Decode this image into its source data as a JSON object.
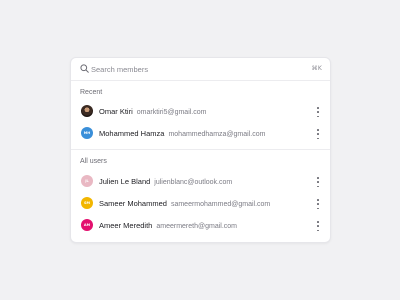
{
  "search": {
    "placeholder": "Search members",
    "shortcut": "⌘K"
  },
  "sections": {
    "recent_title": "Recent",
    "all_title": "All users"
  },
  "recent": [
    {
      "name": "Omar Ktiri",
      "email": "omarktiri5@gmail.com",
      "avatar_initials": "",
      "avatar_color": "#2a1d17"
    },
    {
      "name": "Mohammed Hamza",
      "email": "mohammedhamza@gmail.com",
      "avatar_initials": "MH",
      "avatar_color": "#3a8fd9"
    }
  ],
  "all_users": [
    {
      "name": "Julien Le Bland",
      "email": "julienblanc@outlook.com",
      "avatar_initials": "JL",
      "avatar_color": "#e9b8c3"
    },
    {
      "name": "Sameer Mohammed",
      "email": "sameermohammed@gmail.com",
      "avatar_initials": "SM",
      "avatar_color": "#f2b600"
    },
    {
      "name": "Ameer Meredith",
      "email": "ameermereth@gmail.com",
      "avatar_initials": "AM",
      "avatar_color": "#e3106e"
    }
  ]
}
